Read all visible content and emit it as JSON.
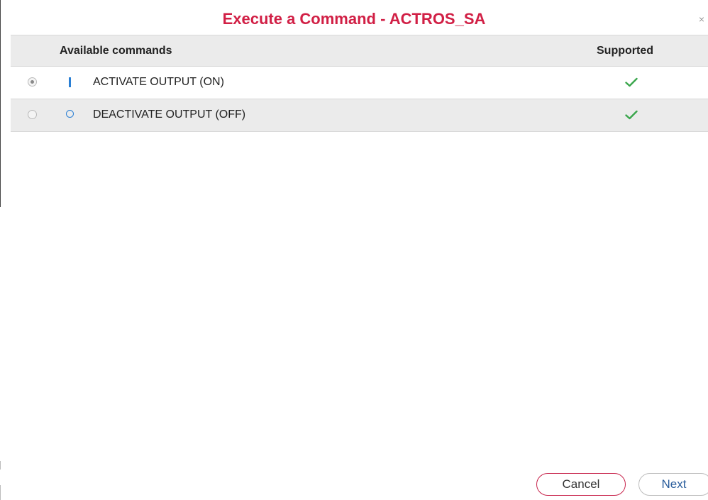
{
  "dialog": {
    "title": "Execute a Command - ACTROS_SA",
    "close_symbol": "×"
  },
  "table": {
    "headers": {
      "commands": "Available commands",
      "supported": "Supported"
    },
    "rows": [
      {
        "label": "ACTIVATE OUTPUT (ON)",
        "icon": "power-on-icon",
        "selected": true,
        "supported": true
      },
      {
        "label": "DEACTIVATE OUTPUT (OFF)",
        "icon": "power-off-icon",
        "selected": false,
        "supported": true
      }
    ]
  },
  "buttons": {
    "cancel_label": "Cancel",
    "next_label": "Next"
  },
  "colors": {
    "title": "#d11f45",
    "command_icon": "#2a7fd4",
    "check": "#3aa64c",
    "cancel_border": "#c8244c",
    "next_text": "#2a5d9c",
    "row_alt_background": "#ebebeb"
  }
}
